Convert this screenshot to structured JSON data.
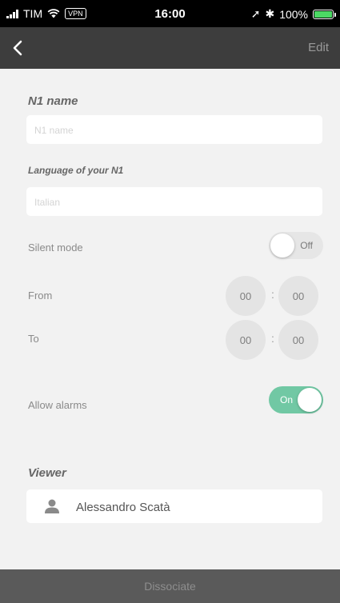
{
  "status_bar": {
    "carrier": "TIM",
    "vpn": "VPN",
    "time": "16:00",
    "location_glyph": "➚",
    "bluetooth_glyph": "✱",
    "battery": "100%"
  },
  "nav": {
    "back_icon": "chevron-left-icon",
    "edit_label": "Edit"
  },
  "device": {
    "name_title": "N1 name",
    "name_placeholder": "N1 name",
    "language_title": "Language of your N1",
    "language_value": "Italian"
  },
  "silent_mode": {
    "label": "Silent mode",
    "state": "Off",
    "from_label": "From",
    "from_hours": "00",
    "from_minutes": "00",
    "to_label": "To",
    "to_hours": "00",
    "to_minutes": "00",
    "separator": ":"
  },
  "alarms": {
    "label": "Allow alarms",
    "state": "On"
  },
  "viewer": {
    "title": "Viewer",
    "name": "Alessandro Scatà",
    "icon": "user-icon"
  },
  "footer": {
    "dissociate_label": "Dissociate"
  },
  "colors": {
    "nav_bar": "#3d3d3d",
    "background": "#f2f2f2",
    "toggle_on": "#71c8a4",
    "toggle_off": "#e6e6e6",
    "footer": "#5a5a5a"
  }
}
